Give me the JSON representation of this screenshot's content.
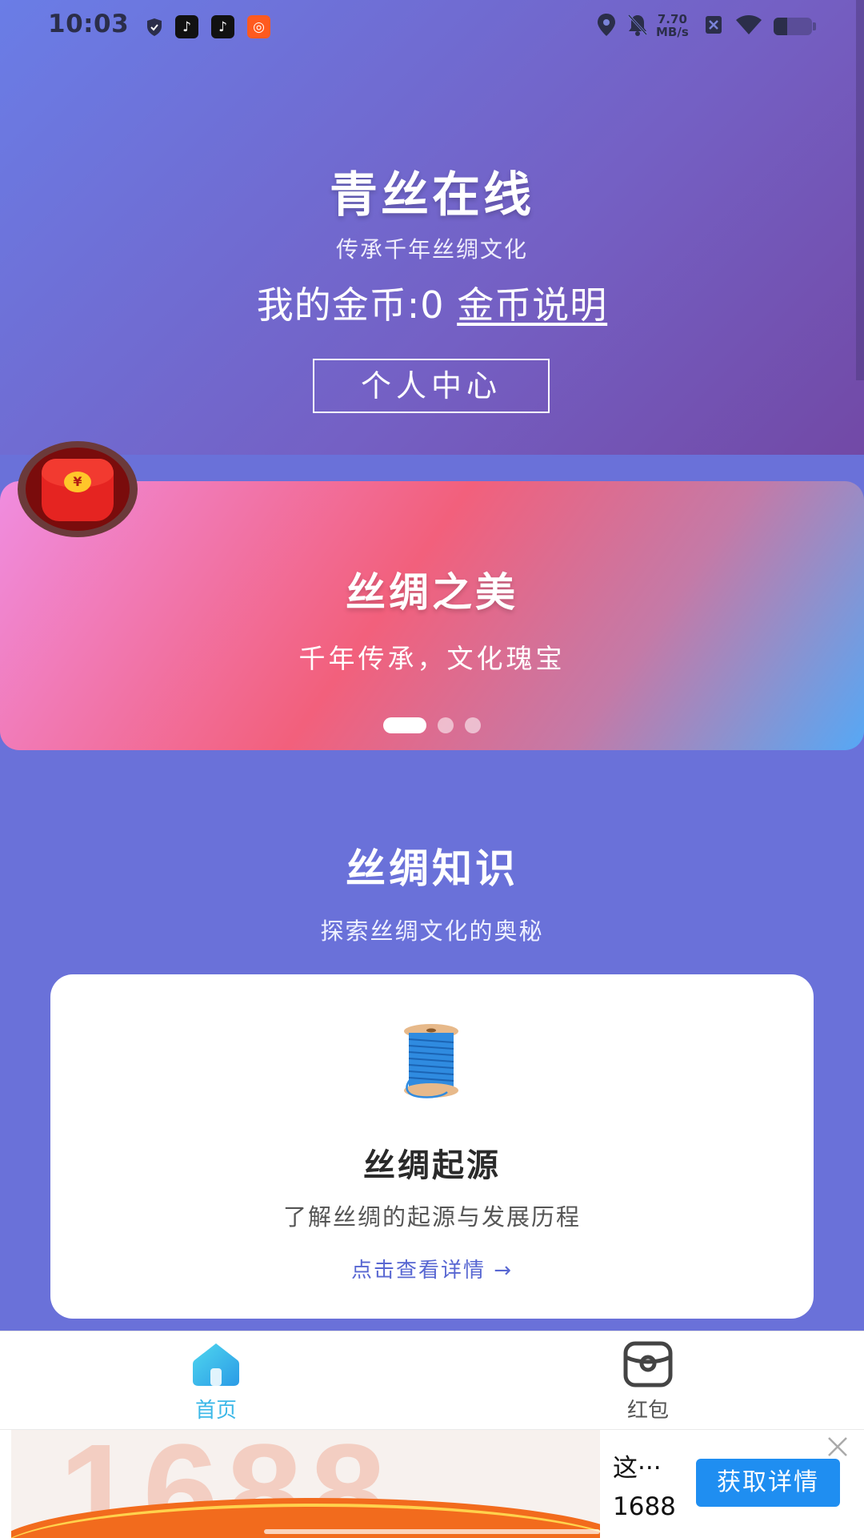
{
  "status_bar": {
    "time": "10:03",
    "speed_value": "7.70",
    "speed_unit": "MB/s",
    "battery_level": 0.35,
    "icons": [
      "shield-icon",
      "tiktok-icon",
      "tiktok-lite-icon",
      "kuaishou-icon",
      "location-icon",
      "mute-bell-icon",
      "sim-off-icon",
      "wifi-icon",
      "battery-icon"
    ]
  },
  "header": {
    "title": "青丝在线",
    "subtitle": "传承千年丝绸文化",
    "coins_label": "我的金币:0",
    "coins_link": "金币说明",
    "personal_center_button": "个人中心"
  },
  "banner": {
    "title": "丝绸之美",
    "subtitle": "千年传承，文化瑰宝",
    "slide_count": 3,
    "active_slide": 0
  },
  "red_packet": {
    "icon": "red-packet-icon",
    "symbol": "¥"
  },
  "section": {
    "title": "丝绸知识",
    "subtitle": "探索丝绸文化的奥秘"
  },
  "card": {
    "icon": "thread-spool-icon",
    "title": "丝绸起源",
    "description": "了解丝绸的起源与发展历程",
    "link": "点击查看详情 →"
  },
  "bottom_nav": {
    "items": [
      {
        "label": "首页",
        "icon": "home-icon",
        "active": true
      },
      {
        "label": "红包",
        "icon": "red-packet-nav-icon",
        "active": false
      }
    ],
    "active_color": "#3cb8e8",
    "inactive_color": "#555555"
  },
  "ad": {
    "brand_text": "1688",
    "title": "这···",
    "sub": "1688",
    "button": "获取详情"
  },
  "colors": {
    "header_start": "#6a7de6",
    "header_end": "#7249a6",
    "page_bg": "#6a71d9",
    "link_blue": "#5867d2",
    "ad_button": "#1f8ef1"
  }
}
